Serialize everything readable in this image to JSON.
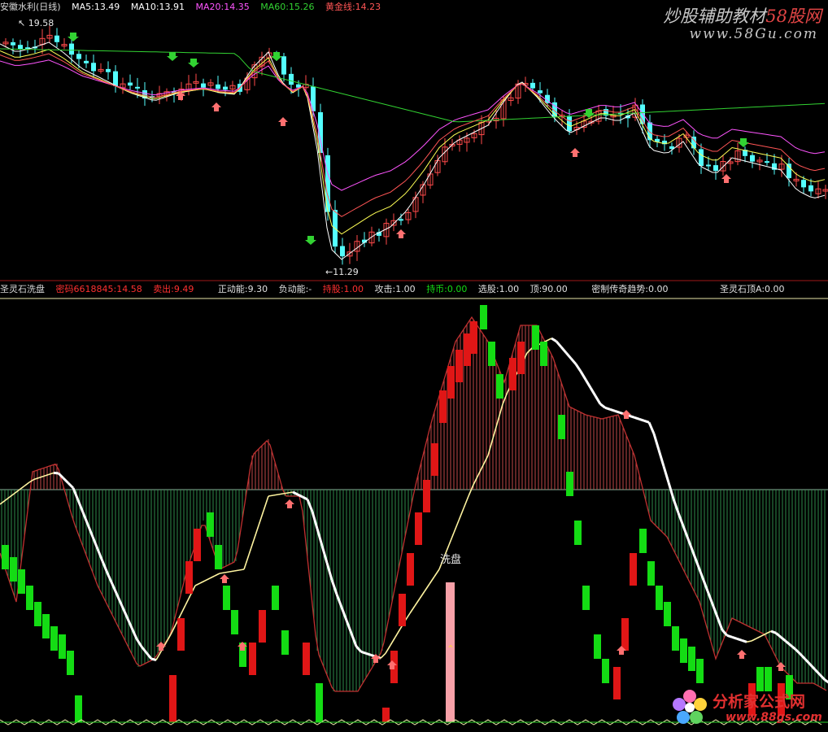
{
  "top_header": {
    "title": "安徽水利(日线)",
    "ma5": "MA5:13.49",
    "ma10": "MA10:13.91",
    "ma20": "MA20:14.35",
    "ma60": "MA60:15.26",
    "gold": "黄金线:14.23"
  },
  "price_labels": {
    "high": "19.58",
    "low": "11.29"
  },
  "bottom_header": {
    "title": "圣灵石洗盘",
    "password": "密码6618845:14.58",
    "sell": "卖出:9.49",
    "pos_energy": "正动能:9.30",
    "neg_energy": "负动能:-",
    "hold": "持股:1.00",
    "attack": "攻击:1.00",
    "hold_coin": "持币:0.00",
    "pick": "选股:1.00",
    "top": "顶:90.00",
    "trend": "密制传奇趋势:0.00",
    "top_a": "圣灵石顶A:0.00"
  },
  "annotation": "洗盘",
  "watermarks": {
    "top_main": "炒股辅助教材",
    "top_highlight": "58股网",
    "top_url": "www.58Gu.com",
    "bottom_main": "分析家公式网",
    "bottom_url": "www.88gs.com"
  },
  "colors": {
    "up": "#ff4a4a",
    "down": "#54ffff",
    "ma5": "#ffffff",
    "ma10": "#ffff55",
    "ma20": "#ff55ff",
    "ma60": "#32d232",
    "gold": "#ff5555",
    "hist_green": "#14dc14",
    "hist_red": "#e01616",
    "wash_bar": "#f7a0a8"
  }
}
